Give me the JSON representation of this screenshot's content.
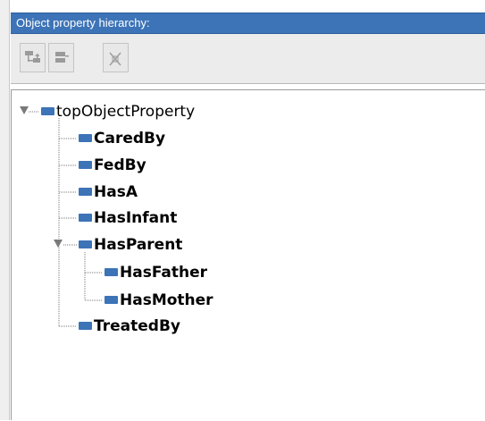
{
  "panel": {
    "title": "Object property hierarchy:",
    "accent_color": "#3d74b8",
    "node_color": "#3d73b7"
  },
  "toolbar": {
    "buttons": [
      {
        "name": "add-subproperty-button",
        "icon": "add-sub-icon",
        "enabled": false
      },
      {
        "name": "add-sibling-property-button",
        "icon": "add-sibling-icon",
        "enabled": false
      },
      {
        "name": "delete-property-button",
        "icon": "delete-icon",
        "enabled": false
      }
    ]
  },
  "tree": {
    "root": {
      "label": "topObjectProperty",
      "expanded": true,
      "children": [
        {
          "label": "CaredBy"
        },
        {
          "label": "FedBy"
        },
        {
          "label": "HasA"
        },
        {
          "label": "HasInfant"
        },
        {
          "label": "HasParent",
          "expanded": true,
          "children": [
            {
              "label": "HasFather"
            },
            {
              "label": "HasMother"
            }
          ]
        },
        {
          "label": "TreatedBy"
        }
      ]
    }
  }
}
